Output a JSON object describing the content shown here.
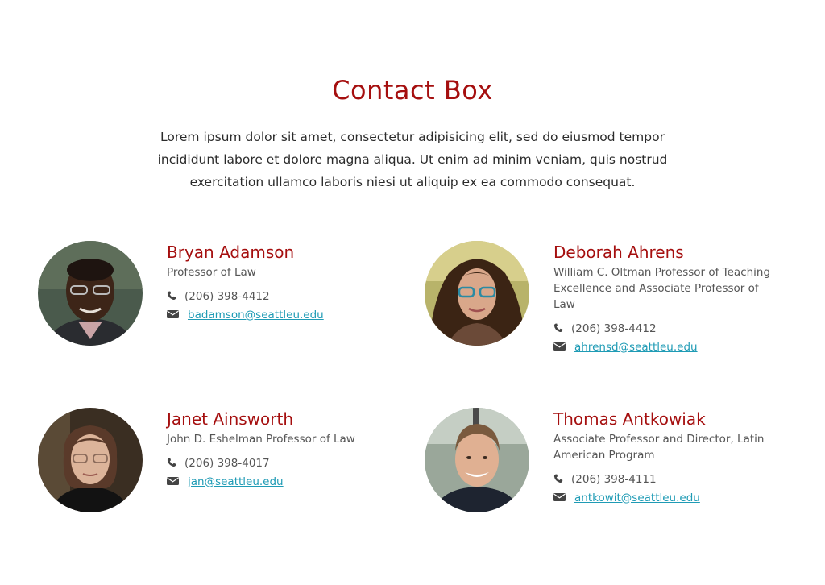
{
  "title": "Contact Box",
  "intro": "Lorem ipsum dolor sit amet, consectetur adipisicing elit, sed do eiusmod tempor incididunt labore et dolore magna aliqua. Ut enim ad minim veniam, quis nostrud exercitation ullamco laboris niesi ut aliquip ex ea commodo consequat.",
  "colors": {
    "accent": "#a50f0f",
    "link": "#1f9bb5",
    "body_text": "#2b2b2b",
    "muted_text": "#555555"
  },
  "contacts": [
    {
      "name": "Bryan Adamson",
      "role": "Professor of Law",
      "phone": "(206) 398-4412",
      "email": "badamson@seattleu.edu",
      "phone_icon": "phone-icon",
      "email_icon": "envelope-icon"
    },
    {
      "name": "Deborah Ahrens",
      "role": "William C. Oltman Professor of Teaching Excellence and Associate Professor of Law",
      "phone": "(206) 398-4412",
      "email": "ahrensd@seattleu.edu",
      "phone_icon": "phone-icon",
      "email_icon": "envelope-icon"
    },
    {
      "name": "Janet Ainsworth",
      "role": "John D. Eshelman Professor of Law",
      "phone": "(206) 398-4017",
      "email": "jan@seattleu.edu",
      "phone_icon": "phone-icon",
      "email_icon": "envelope-icon"
    },
    {
      "name": "Thomas Antkowiak",
      "role": "Associate Professor and Director, Latin American Program",
      "phone": "(206) 398-4111",
      "email": "antkowit@seattleu.edu",
      "phone_icon": "phone-icon",
      "email_icon": "envelope-icon"
    }
  ]
}
